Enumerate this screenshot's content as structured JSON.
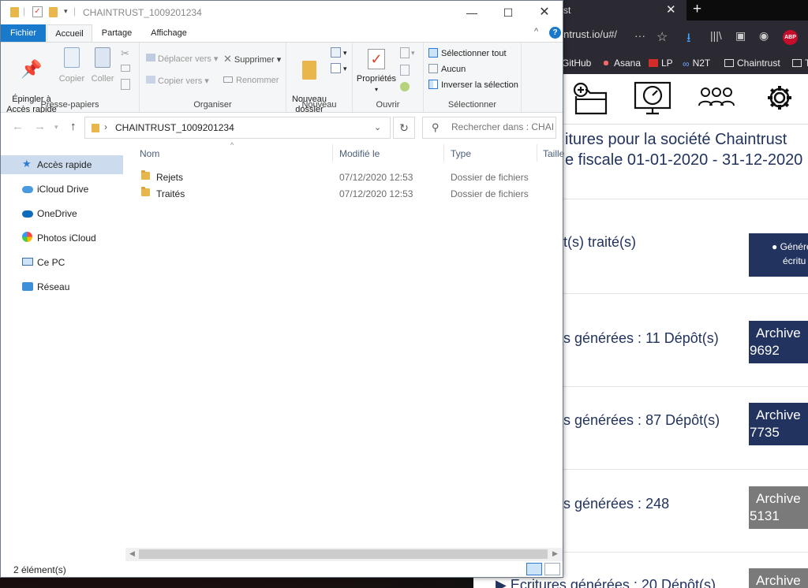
{
  "browser": {
    "tab_title": "trust",
    "tab_close": "✕",
    "new_tab": "+",
    "url": "aintrust.io/u#/",
    "url_more": "···",
    "abp": "ABP",
    "bookmarks": [
      "GitHub",
      "Asana",
      "LP",
      "N2T",
      "Chaintrust",
      "T"
    ],
    "content_title_line1": "itures pour la société Chaintrust",
    "content_title_line2": "e fiscale 01-01-2020 - 31-12-2020",
    "rows": [
      {
        "text": "t(s) traité(s)",
        "btn_line1": "● Généré",
        "btn_line2": "écritu",
        "btn_color": "#21335e"
      },
      {
        "text": "s générées : 11 Dépôt(s)",
        "btn_line1": "Archive",
        "btn_line2": "9692",
        "btn_color": "#21335e"
      },
      {
        "text": "s générées : 87 Dépôt(s)",
        "btn_line1": "Archive",
        "btn_line2": "7735",
        "btn_color": "#21335e"
      },
      {
        "text": "s générées : 248",
        "btn_line1": "Archive",
        "btn_line2": "5131",
        "btn_color": "#7a7a7a"
      }
    ],
    "last_row_text": "▶ Ecritures générées : 20 Dépôt(s)",
    "last_row_btn": "Archive"
  },
  "explorer": {
    "window_title": "CHAINTRUST_1009201234",
    "tabs": {
      "fichier": "Fichier",
      "accueil": "Accueil",
      "partage": "Partage",
      "affichage": "Affichage"
    },
    "groups": {
      "presse_papiers": "Presse-papiers",
      "organiser": "Organiser",
      "nouveau": "Nouveau",
      "ouvrir": "Ouvrir",
      "selectionner": "Sélectionner"
    },
    "ribbon": {
      "epingler": "Épingler à\nAccès rapide",
      "copier": "Copier",
      "coller": "Coller",
      "deplacer_vers": "Déplacer vers",
      "copier_vers": "Copier vers",
      "supprimer": "Supprimer",
      "renommer": "Renommer",
      "nouveau_dossier": "Nouveau\ndossier",
      "proprietes": "Propriétés",
      "selectionner_tout": "Sélectionner tout",
      "aucun": "Aucun",
      "inverser": "Inverser la sélection"
    },
    "address": "CHAINTRUST_1009201234",
    "search_placeholder": "Rechercher dans : CHAI...",
    "nav": [
      {
        "label": "Accès rapide",
        "icon": "star-icon"
      },
      {
        "label": "iCloud Drive",
        "icon": "icloud-icon"
      },
      {
        "label": "OneDrive",
        "icon": "onedrive-icon"
      },
      {
        "label": "Photos iCloud",
        "icon": "photos-icon"
      },
      {
        "label": "Ce PC",
        "icon": "pc-icon"
      },
      {
        "label": "Réseau",
        "icon": "network-icon"
      }
    ],
    "columns": {
      "name": "Nom",
      "modified": "Modifié le",
      "type": "Type",
      "size": "Taille"
    },
    "files": [
      {
        "name": "Rejets",
        "modified": "07/12/2020 12:53",
        "type": "Dossier de fichiers"
      },
      {
        "name": "Traités",
        "modified": "07/12/2020 12:53",
        "type": "Dossier de fichiers"
      }
    ],
    "status": "2 élément(s)",
    "colors": {
      "accent": "#1979ca",
      "folder": "#e8b64a",
      "nav_selected": "#ccdcee"
    }
  }
}
